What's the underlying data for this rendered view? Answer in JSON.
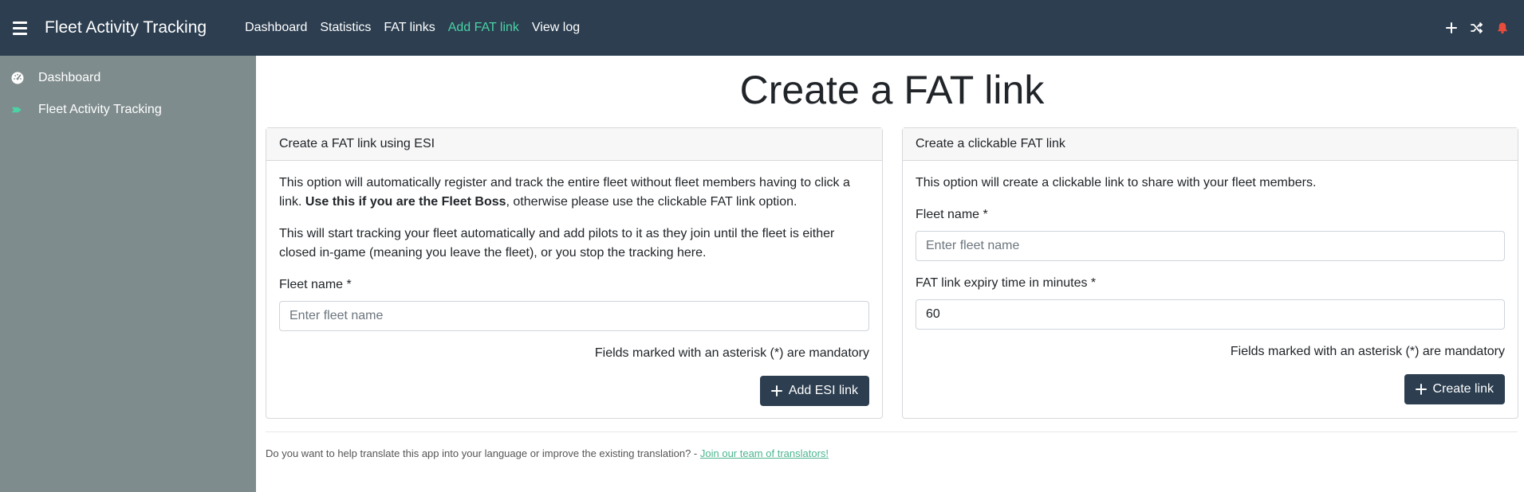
{
  "header": {
    "brand": "Fleet Activity Tracking",
    "nav": [
      {
        "label": "Dashboard"
      },
      {
        "label": "Statistics"
      },
      {
        "label": "FAT links"
      },
      {
        "label": "Add FAT link"
      },
      {
        "label": "View log"
      }
    ],
    "active_nav": "Add FAT link",
    "icons": [
      "plus-icon",
      "shuffle-icon",
      "bell-icon"
    ],
    "accent_color": "#4bd2a5",
    "bg_color": "#2c3e50",
    "bell_color": "#e74c3c"
  },
  "sidebar": {
    "items": [
      {
        "label": "Dashboard",
        "icon": "dashboard-gauge-icon"
      },
      {
        "label": "Fleet Activity Tracking",
        "icon": "flag-icon"
      }
    ],
    "bg_color": "#7f8c8d"
  },
  "page": {
    "title": "Create a FAT link"
  },
  "esi_card": {
    "header": "Create a FAT link using ESI",
    "para1_before": "This option will automatically register and track the entire fleet without fleet members having to click a link. ",
    "para1_bold": "Use this if you are the Fleet Boss",
    "para1_after": ", otherwise please use the clickable FAT link option.",
    "para2": "This will start tracking your fleet automatically and add pilots to it as they join until the fleet is either closed in-game (meaning you leave the fleet), or you stop the tracking here.",
    "fleet_name_label": "Fleet name *",
    "fleet_name_placeholder": "Enter fleet name",
    "fleet_name_value": "",
    "mandatory_note": "Fields marked with an asterisk (*) are mandatory",
    "button_label": "Add ESI link"
  },
  "click_card": {
    "header": "Create a clickable FAT link",
    "para1": "This option will create a clickable link to share with your fleet members.",
    "fleet_name_label": "Fleet name *",
    "fleet_name_placeholder": "Enter fleet name",
    "fleet_name_value": "",
    "expiry_label": "FAT link expiry time in minutes *",
    "expiry_value": "60",
    "mandatory_note": "Fields marked with an asterisk (*) are mandatory",
    "button_label": "Create link"
  },
  "footer": {
    "text": "Do you want to help translate this app into your language or improve the existing translation? - ",
    "link": "Join our team of translators!",
    "link_color": "#4bb58f"
  }
}
